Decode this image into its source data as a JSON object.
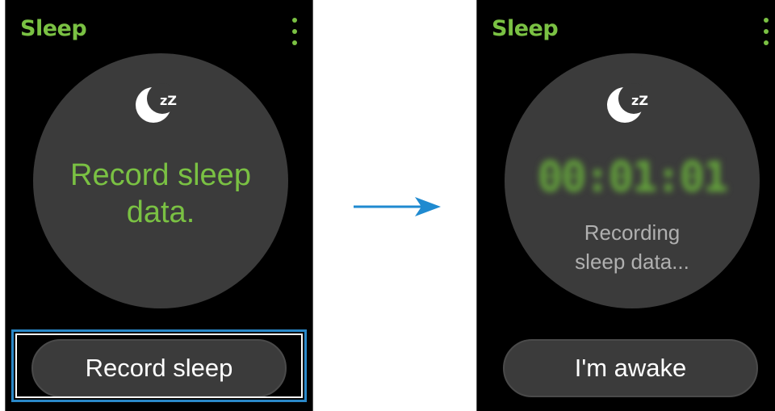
{
  "left_screen": {
    "title": "Sleep",
    "menu_icon": "more-vertical-icon",
    "sleep_icon": "moon-zz-icon",
    "message": "Record sleep\ndata.",
    "button_label": "Record sleep"
  },
  "right_screen": {
    "title": "Sleep",
    "menu_icon": "more-vertical-icon",
    "sleep_icon": "moon-zz-icon",
    "timer": "00:01:01",
    "status": "Recording\nsleep data...",
    "button_label": "I'm awake"
  },
  "moon_badge": "zZ",
  "colors": {
    "accent_green": "#7ac143",
    "surface": "#3b3b3b",
    "background": "#000000",
    "highlight_blue": "#2a88c8",
    "arrow_blue": "#1f8ad0"
  }
}
